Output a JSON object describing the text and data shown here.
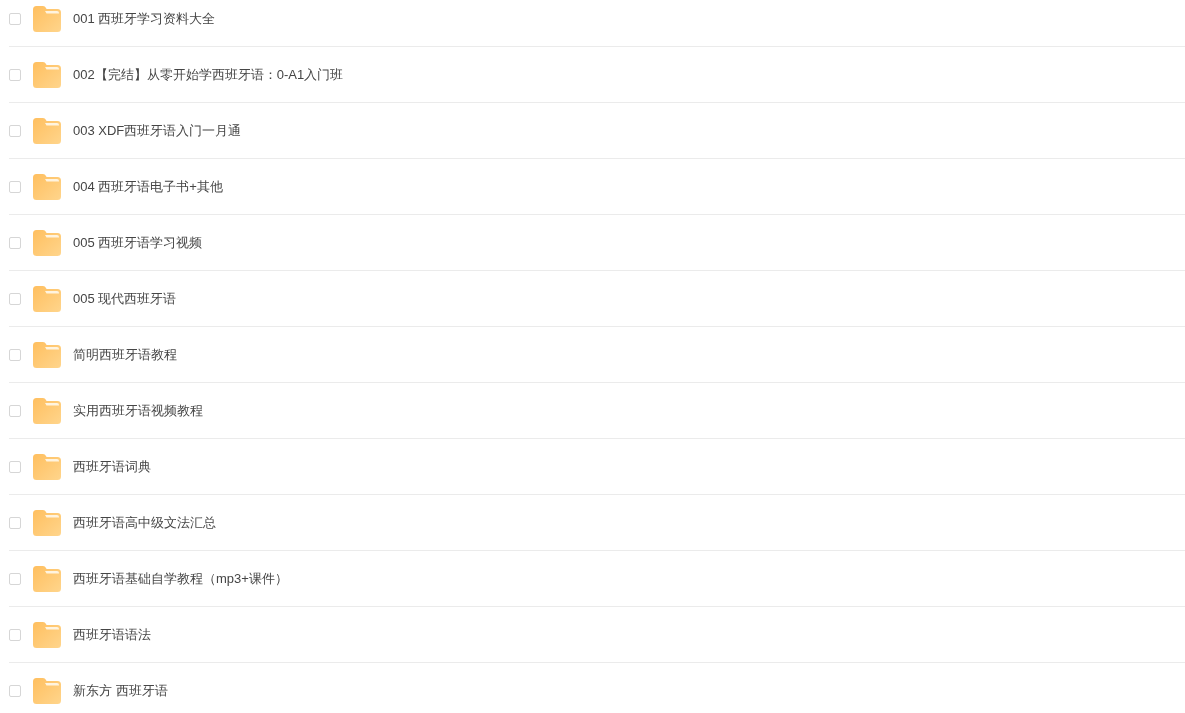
{
  "files": [
    {
      "name": "001 西班牙学习资料大全",
      "checked": false
    },
    {
      "name": "002【完结】从零开始学西班牙语：0-A1入门班",
      "checked": false
    },
    {
      "name": "003 XDF西班牙语入门一月通",
      "checked": false
    },
    {
      "name": "004 西班牙语电子书+其他",
      "checked": false
    },
    {
      "name": "005 西班牙语学习视频",
      "checked": false
    },
    {
      "name": "005 现代西班牙语",
      "checked": false
    },
    {
      "name": "简明西班牙语教程",
      "checked": false
    },
    {
      "name": "实用西班牙语视频教程",
      "checked": false
    },
    {
      "name": "西班牙语词典",
      "checked": false
    },
    {
      "name": "西班牙语高中级文法汇总",
      "checked": false
    },
    {
      "name": "西班牙语基础自学教程（mp3+课件）",
      "checked": false
    },
    {
      "name": "西班牙语语法",
      "checked": false
    },
    {
      "name": "新东方 西班牙语",
      "checked": false
    }
  ]
}
